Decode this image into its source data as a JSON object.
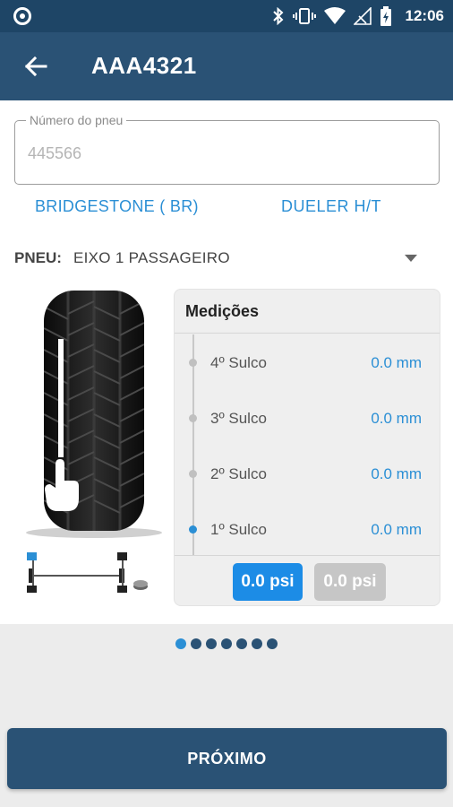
{
  "status_bar": {
    "time": "12:06"
  },
  "app_bar": {
    "title": "AAA4321"
  },
  "tire_number_field": {
    "label": "Número do pneu",
    "value": "445566"
  },
  "tire_info": {
    "brand": "BRIDGESTONE ( BR)",
    "model": "DUELER H/T"
  },
  "tire_selector": {
    "label": "PNEU:",
    "value": "EIXO 1 PASSAGEIRO"
  },
  "measurements": {
    "title": "Medições",
    "rows": [
      {
        "label": "4º Sulco",
        "value": "0.0 mm"
      },
      {
        "label": "3º Sulco",
        "value": "0.0 mm"
      },
      {
        "label": "2º Sulco",
        "value": "0.0 mm"
      },
      {
        "label": "1º Sulco",
        "value": "0.0 mm"
      }
    ],
    "pressure_buttons": [
      "0.0 psi",
      "0.0 psi"
    ]
  },
  "pager": {
    "count": 7,
    "active_index": 0
  },
  "next_button": {
    "label": "PRÓXIMO"
  },
  "colors": {
    "primary": "#2a5275",
    "status_bar": "#1e4566",
    "accent": "#2b8fd5",
    "psi_active": "#1c8ce6",
    "psi_inactive": "#c6c6c6"
  }
}
